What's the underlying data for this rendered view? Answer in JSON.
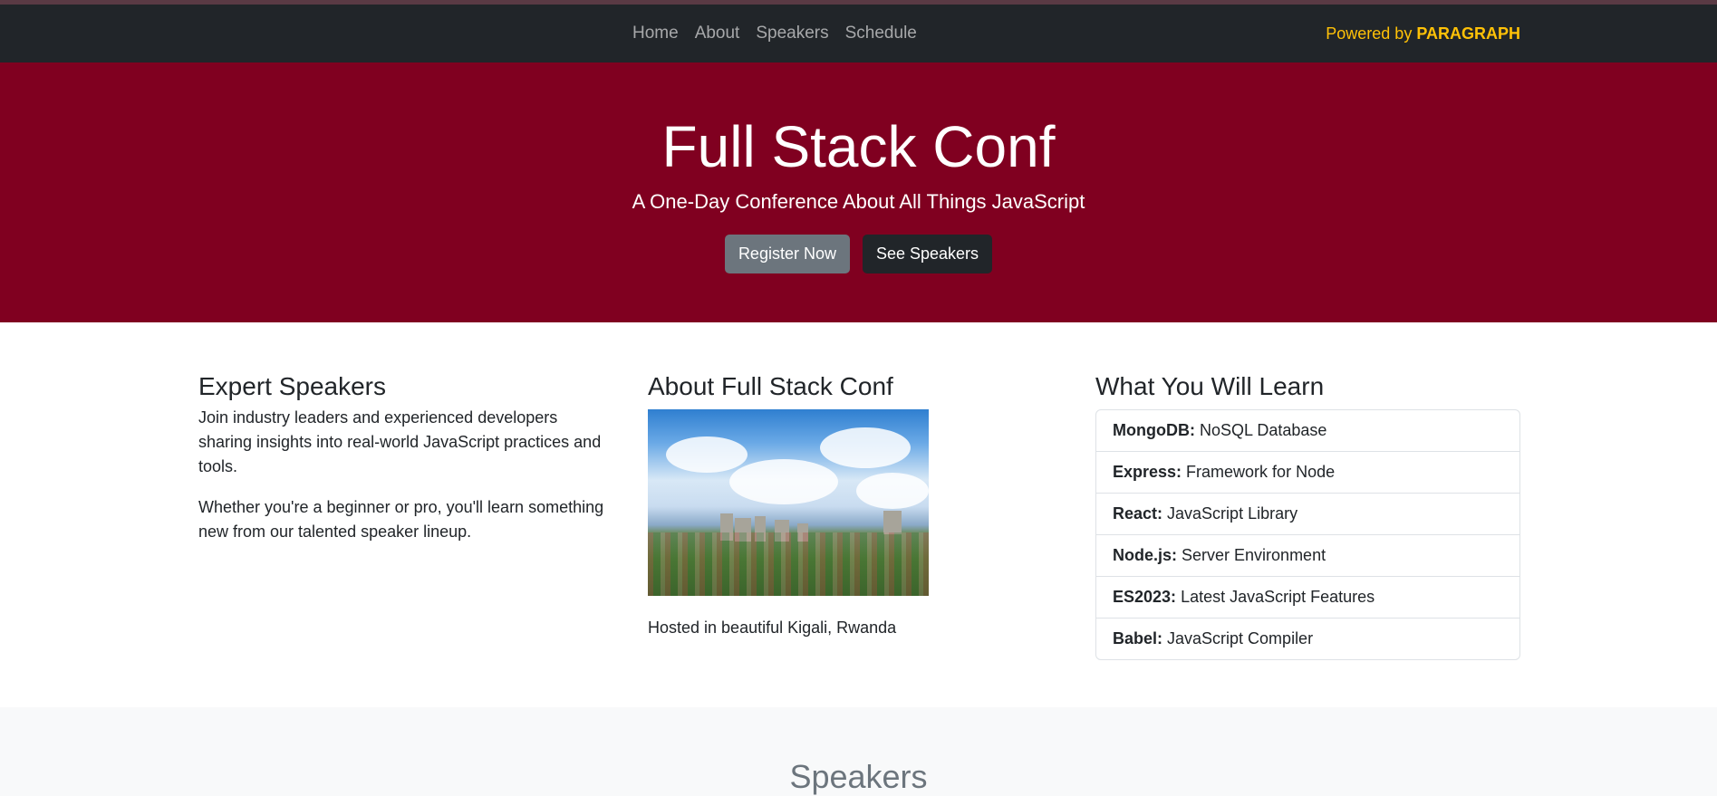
{
  "nav": {
    "links": [
      "Home",
      "About",
      "Speakers",
      "Schedule"
    ],
    "powered_prefix": "Powered by",
    "powered_brand": "PARAGRAPH"
  },
  "hero": {
    "title": "Full Stack Conf",
    "subtitle": "A One-Day Conference About All Things JavaScript",
    "register_label": "Register Now",
    "speakers_label": "See Speakers"
  },
  "columns": {
    "speakers": {
      "heading": "Expert Speakers",
      "p1": "Join industry leaders and experienced developers sharing insights into real-world JavaScript practices and tools.",
      "p2": "Whether you're a beginner or pro, you'll learn something new from our talented speaker lineup."
    },
    "about": {
      "heading": "About Full Stack Conf",
      "caption": "Hosted in beautiful Kigali, Rwanda"
    },
    "learn": {
      "heading": "What You Will Learn",
      "items": [
        {
          "name": "MongoDB:",
          "desc": "NoSQL Database"
        },
        {
          "name": "Express:",
          "desc": "Framework for Node"
        },
        {
          "name": "React:",
          "desc": "JavaScript Library"
        },
        {
          "name": "Node.js:",
          "desc": "Server Environment"
        },
        {
          "name": "ES2023:",
          "desc": "Latest JavaScript Features"
        },
        {
          "name": "Babel:",
          "desc": "JavaScript Compiler"
        }
      ]
    }
  },
  "speakers_section": {
    "title": "Speakers"
  },
  "colors": {
    "navbar": "#212529",
    "hero_bg": "#800020",
    "accent_yellow": "#ffc107",
    "btn_secondary": "#6c757d",
    "btn_dark": "#212529"
  }
}
